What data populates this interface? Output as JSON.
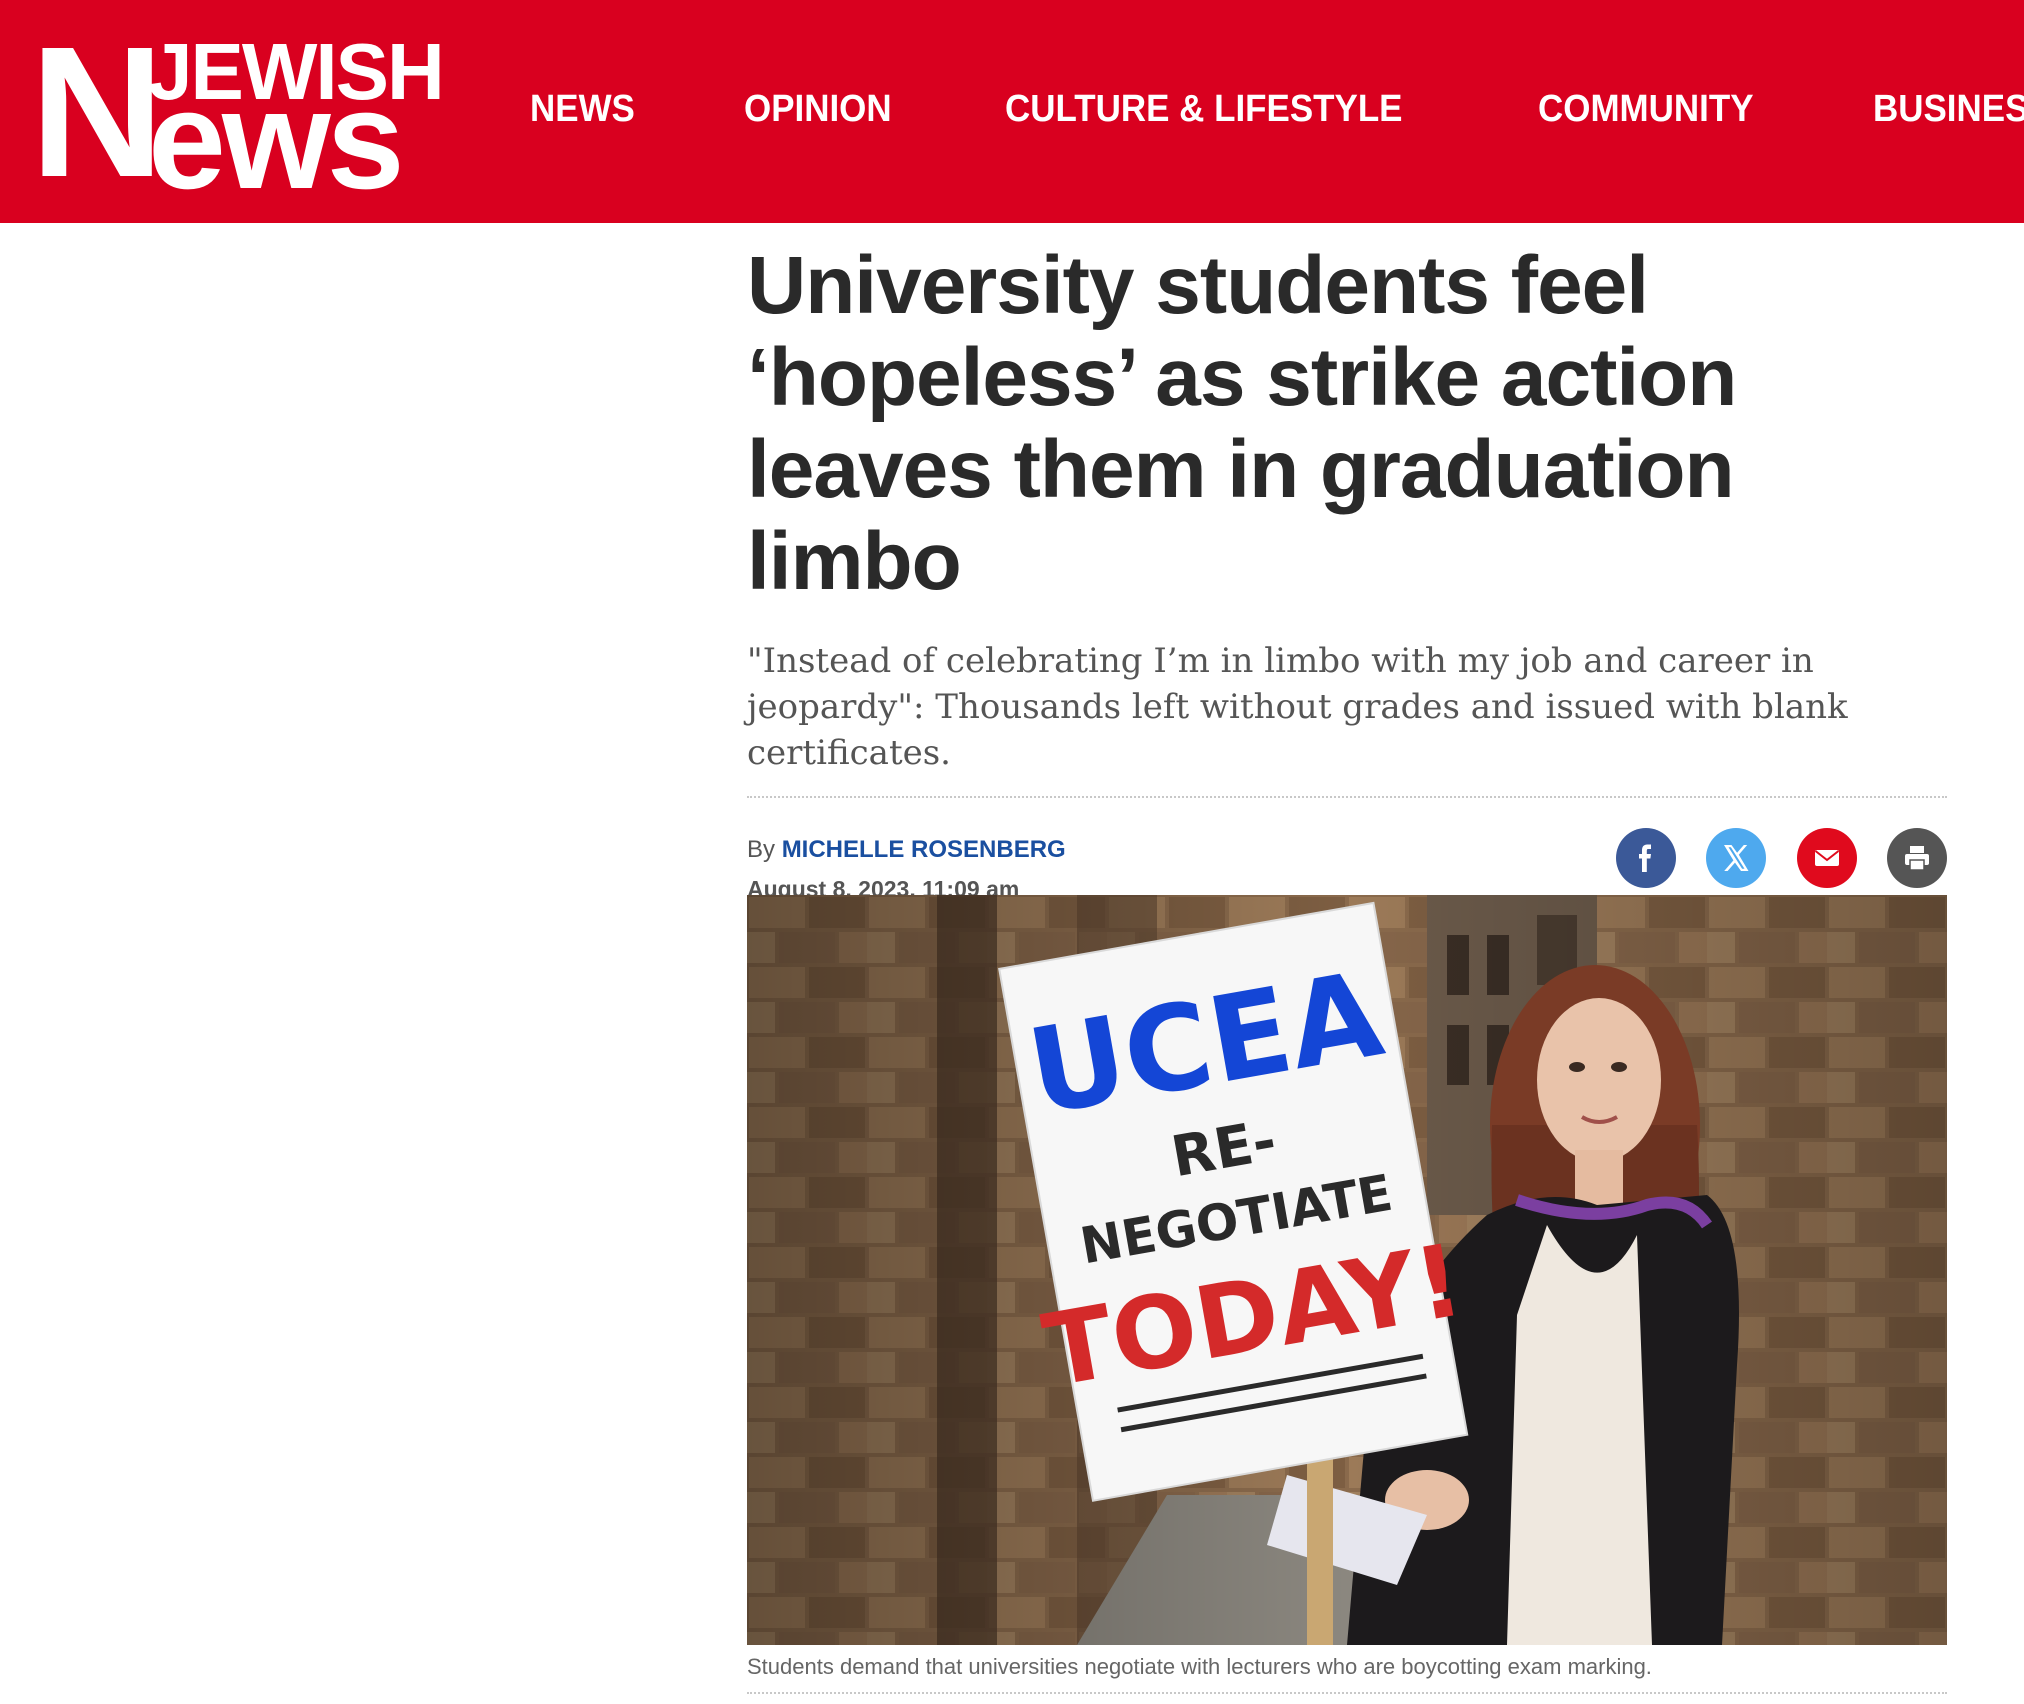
{
  "header": {
    "logo": {
      "big_letter": "N",
      "top_word": "JEWISH",
      "bottom_word": "ews"
    },
    "nav": [
      "NEWS",
      "OPINION",
      "CULTURE & LIFESTYLE",
      "COMMUNITY",
      "BUSINESS & TECH"
    ],
    "bar_color": "#d9001f"
  },
  "article": {
    "headline": "University students feel ‘hopeless’ as strike action leaves them in graduation limbo",
    "subheadline": "\"Instead of celebrating I’m in limbo with my job and career in jeopardy\": Thousands left without grades and issued with blank certificates.",
    "byline_prefix": "By",
    "author": "MICHELLE ROSENBERG",
    "date": "August 8, 2023, 11:09 am",
    "share": [
      {
        "name": "facebook-icon",
        "color": "#3b5998"
      },
      {
        "name": "x-icon",
        "color": "#4ea9ee"
      },
      {
        "name": "email-icon",
        "color": "#e00a1d"
      },
      {
        "name": "print-icon",
        "color": "#555555"
      }
    ],
    "image": {
      "placard": {
        "line1": "UCEA",
        "line2": "RE-",
        "line3": "NEGOTIATE",
        "line4": "TODAY!"
      }
    },
    "caption": "Students demand that universities negotiate with lecturers who are boycotting exam marking."
  }
}
